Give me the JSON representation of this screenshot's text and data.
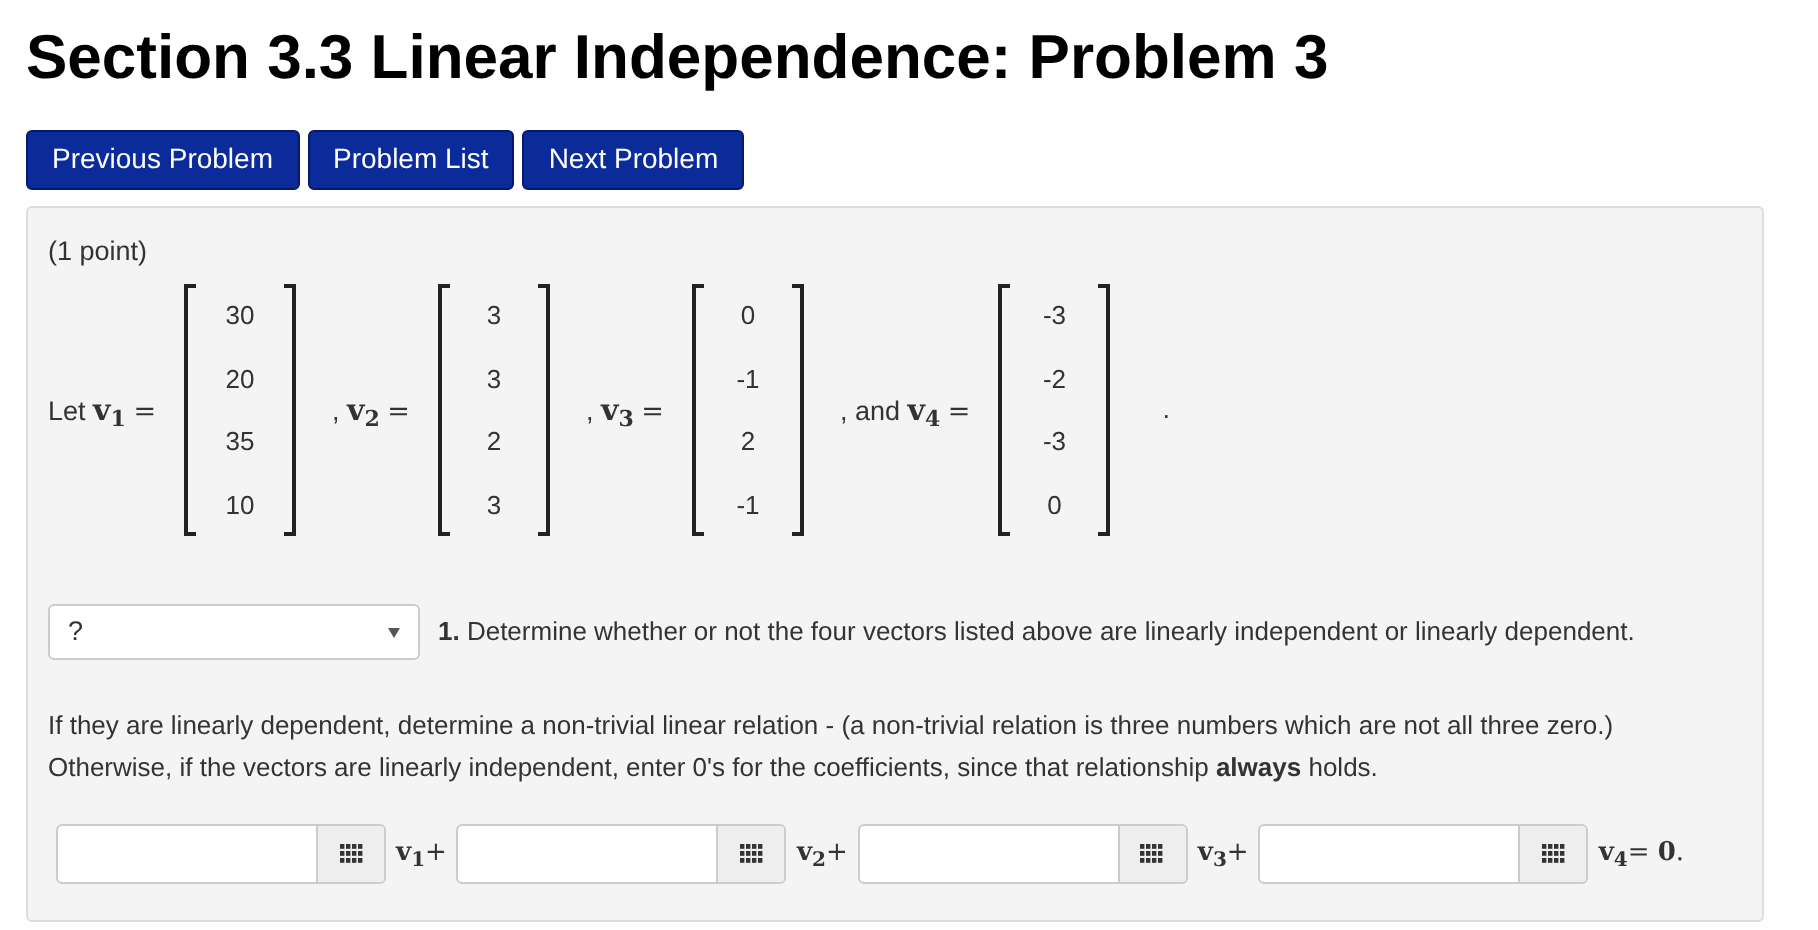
{
  "title": "Section 3.3 Linear Independence: Problem 3",
  "nav_buttons": [
    "Previous Problem",
    "Problem List",
    "Next Problem"
  ],
  "points": "(1 point)",
  "vectors": [
    {
      "prefix": "Let",
      "name": "v",
      "sub": "1",
      "equals": "=",
      "entries": [
        "30",
        "20",
        "35",
        "10"
      ]
    },
    {
      "prefix": ",",
      "name": "v",
      "sub": "2",
      "equals": "=",
      "entries": [
        "3",
        "3",
        "2",
        "3"
      ]
    },
    {
      "prefix": ",",
      "name": "v",
      "sub": "3",
      "equals": "=",
      "entries": [
        "0",
        "-1",
        "2",
        "-1"
      ]
    },
    {
      "prefix": ", and",
      "name": "v",
      "sub": "4",
      "equals": "=",
      "entries": [
        "-3",
        "-2",
        "-3",
        "0"
      ]
    }
  ],
  "vectors_end": ".",
  "question": {
    "select": {
      "value": "?"
    },
    "text": "**1.** Determine whether or not the four vectors listed above are linearly independent or linearly dependent."
  },
  "instructions": [
    "If they are linearly dependent, determine a non-trivial linear relation - (a non-trivial relation is three numbers which are not all three zero.)",
    "Otherwise, if the vectors are linearly independent, enter 0's for the coefficients, since that relationship **always** holds."
  ],
  "relation": [
    {
      "name": "v",
      "sub": "1",
      "suffix": "+"
    },
    {
      "name": "v",
      "sub": "2",
      "suffix": "+"
    },
    {
      "name": "v",
      "sub": "3",
      "suffix": "+"
    },
    {
      "name": "v",
      "sub": "4",
      "suffix": "= **0**."
    }
  ]
}
